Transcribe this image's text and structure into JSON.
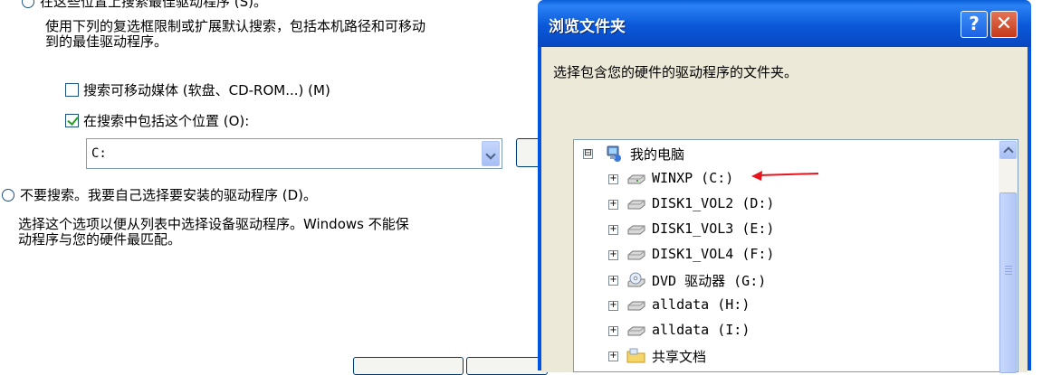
{
  "wizard": {
    "top_radio_label": "在这些位置上搜索最佳驱动程序 (S)。",
    "description": "使用下列的复选框限制或扩展默认搜索，包括本机路径和可移动\n到的最佳驱动程序。",
    "checkbox_removable": {
      "label": "搜索可移动媒体 (软盘、CD-ROM...) (M)",
      "checked": false
    },
    "checkbox_location": {
      "label": "在搜索中包括这个位置 (O):",
      "checked": true
    },
    "path_combo": {
      "value": "C:"
    },
    "dont_search_radio": {
      "label": "不要搜索。我要自己选择要安装的驱动程序 (D)。"
    },
    "dont_search_desc": "选择这个选项以便从列表中选择设备驱动程序。Windows 不能保\n动程序与您的硬件最匹配。"
  },
  "dialog": {
    "title": "浏览文件夹",
    "help_button": "?",
    "close_button": "✕",
    "prompt": "选择包含您的硬件的驱动程序的文件夹。",
    "tree": [
      {
        "label": "我的电脑",
        "icon": "computer-icon",
        "expander": "⊟",
        "level": 0
      },
      {
        "label": "WINXP (C:)",
        "icon": "drive-icon",
        "expander": "+",
        "level": 1
      },
      {
        "label": "DISK1_VOL2 (D:)",
        "icon": "drive-icon",
        "expander": "+",
        "level": 1
      },
      {
        "label": "DISK1_VOL3 (E:)",
        "icon": "drive-icon",
        "expander": "+",
        "level": 1
      },
      {
        "label": "DISK1_VOL4 (F:)",
        "icon": "drive-icon",
        "expander": "+",
        "level": 1
      },
      {
        "label": "DVD 驱动器 (G:)",
        "icon": "dvd-drive-icon",
        "expander": "+",
        "level": 1
      },
      {
        "label": "alldata (H:)",
        "icon": "drive-icon",
        "expander": "+",
        "level": 1
      },
      {
        "label": "alldata (I:)",
        "icon": "drive-icon",
        "expander": "+",
        "level": 1
      },
      {
        "label": "共享文档",
        "icon": "folder-icon",
        "expander": "+",
        "level": 1
      }
    ],
    "annotation_arrow_color": "#e8141c"
  },
  "colors": {
    "titlebar": "#0a58d8",
    "dialog_bg": "#ece9d8",
    "close_button": "#c5381a"
  }
}
